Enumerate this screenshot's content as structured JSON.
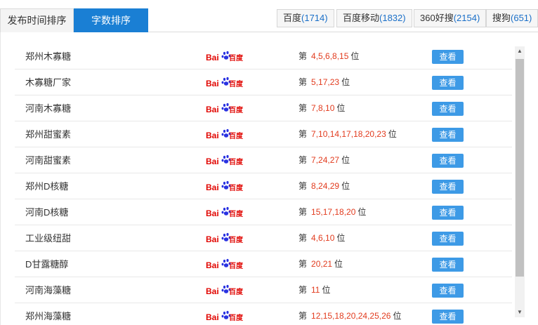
{
  "tabs": [
    {
      "label": "发布时间排序"
    },
    {
      "label": "字数排序"
    }
  ],
  "engines": [
    {
      "name": "百度",
      "count": "(1714)"
    },
    {
      "name": "百度移动",
      "count": "(1832)"
    },
    {
      "name": "360好搜",
      "count": "(2154)"
    },
    {
      "name": "搜狗",
      "count": "(651)"
    }
  ],
  "rank_prefix": "第",
  "rank_suffix": "位",
  "view_label": "查看",
  "rows": [
    {
      "keyword": "郑州木寡糖",
      "positions": "4,5,6,8,15"
    },
    {
      "keyword": "木寡糖厂家",
      "positions": "5,17,23"
    },
    {
      "keyword": "河南木寡糖",
      "positions": "7,8,10"
    },
    {
      "keyword": "郑州甜蜜素",
      "positions": "7,10,14,17,18,20,23"
    },
    {
      "keyword": "河南甜蜜素",
      "positions": "7,24,27"
    },
    {
      "keyword": "郑州D核糖",
      "positions": "8,24,29"
    },
    {
      "keyword": "河南D核糖",
      "positions": "15,17,18,20"
    },
    {
      "keyword": "工业级纽甜",
      "positions": "4,6,10"
    },
    {
      "keyword": "D甘露糖醇",
      "positions": "20,21"
    },
    {
      "keyword": "河南海藻糖",
      "positions": "11"
    },
    {
      "keyword": "郑州海藻糖",
      "positions": "12,15,18,20,24,25,26"
    }
  ],
  "logo": {
    "text_bai": "Bai",
    "text_du": "百度",
    "red": "#e10602",
    "blue": "#2932e1"
  },
  "colors": {
    "accent": "#1a7fd4",
    "button": "#3d9ae6",
    "rank": "#e23b1e",
    "count": "#1a6fc8"
  }
}
